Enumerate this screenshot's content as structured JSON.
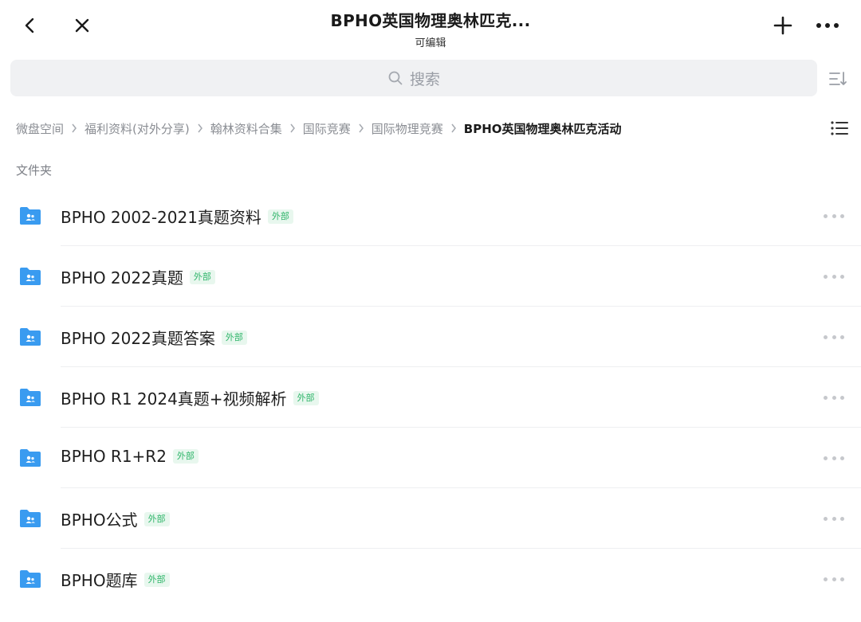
{
  "header": {
    "title": "BPHO英国物理奥林匹克...",
    "subtitle": "可编辑",
    "back_icon": "chevron-left-icon",
    "close_icon": "close-icon",
    "add_icon": "plus-icon",
    "more_icon": "more-horizontal-icon"
  },
  "search": {
    "placeholder": "搜索",
    "icon": "search-icon"
  },
  "breadcrumb": [
    {
      "label": "微盘空间"
    },
    {
      "label": "福利资料(对外分享)"
    },
    {
      "label": "翰林资料合集"
    },
    {
      "label": "国际竞赛"
    },
    {
      "label": "国际物理竞赛"
    },
    {
      "label": "BPHO英国物理奥林匹克活动"
    }
  ],
  "section": {
    "label": "文件夹"
  },
  "folders": [
    {
      "name": "BPHO 2002-2021真题资料",
      "badge": "外部"
    },
    {
      "name": "BPHO 2022真题",
      "badge": "外部"
    },
    {
      "name": "BPHO 2022真题答案",
      "badge": "外部"
    },
    {
      "name": "BPHO R1 2024真题+视频解析",
      "badge": "外部"
    },
    {
      "name": "BPHO R1+R2",
      "badge": "外部"
    },
    {
      "name": "BPHO公式",
      "badge": "外部"
    },
    {
      "name": "BPHO题库",
      "badge": "外部"
    }
  ],
  "colors": {
    "folder": "#3a9bf0",
    "badge_text": "#2fb56a",
    "badge_bg": "#e8f7ee",
    "search_bg": "#f0f1f3"
  }
}
